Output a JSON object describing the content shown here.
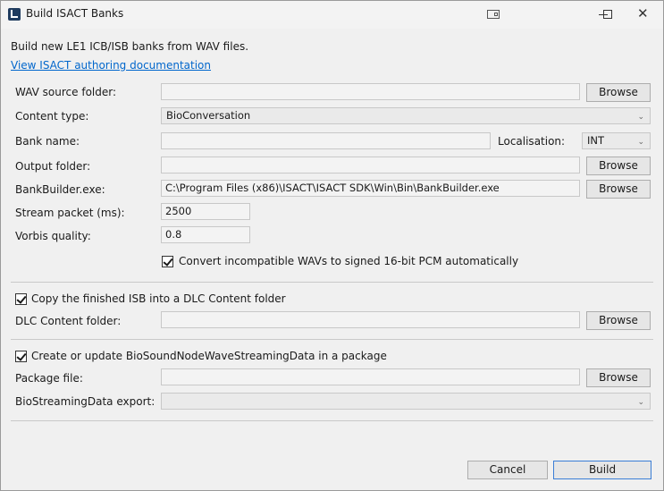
{
  "window": {
    "title": "Build ISACT Banks",
    "close_glyph": "✕"
  },
  "intro": {
    "description": "Build new LE1 ICB/ISB banks from WAV files.",
    "doc_link": "View ISACT authoring documentation"
  },
  "form": {
    "wav_source_label": "WAV source folder:",
    "wav_source_value": "",
    "content_type_label": "Content type:",
    "content_type_value": "BioConversation",
    "bank_name_label": "Bank name:",
    "bank_name_value": "",
    "localisation_label": "Localisation:",
    "localisation_value": "INT",
    "output_folder_label": "Output folder:",
    "output_folder_value": "",
    "bankbuilder_label": "BankBuilder.exe:",
    "bankbuilder_value": "C:\\Program Files (x86)\\ISACT\\ISACT SDK\\Win\\Bin\\BankBuilder.exe",
    "stream_packet_label": "Stream packet (ms):",
    "stream_packet_value": "2500",
    "vorbis_label": "Vorbis quality:",
    "vorbis_value": "0.8",
    "convert_label": "Convert incompatible WAVs to signed 16-bit PCM automatically",
    "convert_checked": true
  },
  "dlc": {
    "copy_label": "Copy the finished ISB into a DLC Content folder",
    "copy_checked": true,
    "folder_label": "DLC Content folder:",
    "folder_value": ""
  },
  "package": {
    "create_label": "Create or update BioSoundNodeWaveStreamingData in a package",
    "create_checked": true,
    "file_label": "Package file:",
    "file_value": "",
    "export_label": "BioStreamingData export:",
    "export_value": ""
  },
  "buttons": {
    "browse": "Browse",
    "cancel": "Cancel",
    "build": "Build"
  },
  "icons": {
    "dropdown": "⌄"
  }
}
